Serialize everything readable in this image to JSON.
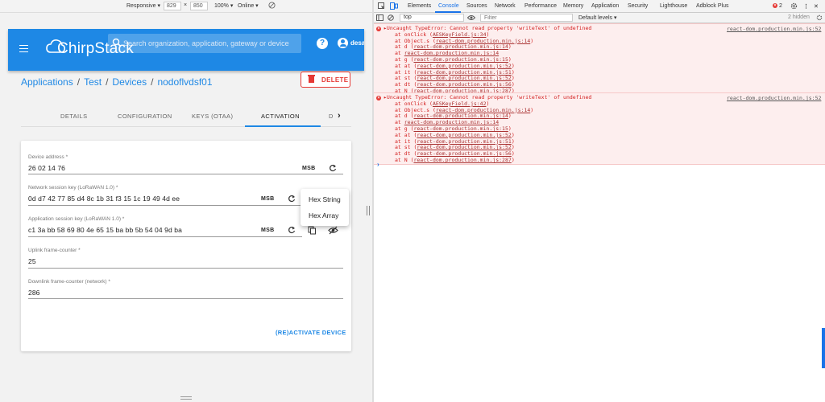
{
  "device_toolbar": {
    "preset": "Responsive ▾",
    "width": "829",
    "times": "×",
    "height": "850",
    "zoom": "100% ▾",
    "network": "Online ▾"
  },
  "app": {
    "logo_text": "ChirpStack",
    "search_placeholder": "Search organization, application, gateway or device",
    "help_label": "?",
    "username": "desar"
  },
  "breadcrumb": {
    "items": [
      "Applications",
      "Test",
      "Devices",
      "nodoflvdsf01"
    ],
    "separator": "/"
  },
  "delete_label": "DELETE",
  "tabs": [
    {
      "label": "DETAILS"
    },
    {
      "label": "CONFIGURATION"
    },
    {
      "label": "KEYS (OTAA)"
    },
    {
      "label": "ACTIVATION"
    },
    {
      "label": "D"
    }
  ],
  "tab_scroll": "›",
  "form": {
    "device_address": {
      "label": "Device address *",
      "value": "26 02 14 76",
      "order": "MSB"
    },
    "nwk_key": {
      "label": "Network session key (LoRaWAN 1.0) *",
      "value": "0d d7 42 77 85 d4 8c 1b 31 f3 15 1c 19 49 4d ee",
      "order": "MSB"
    },
    "app_key": {
      "label": "Application session key (LoRaWAN 1.0) *",
      "value": "c1 3a bb 58 69 80 4e 65 15 ba bb 5b 54 04 9d ba",
      "order": "MSB"
    },
    "uplink": {
      "label": "Uplink frame-counter *",
      "value": "25"
    },
    "downlink": {
      "label": "Downlink frame-counter (network) *",
      "value": "286"
    },
    "activate_label": "(RE)ACTIVATE DEVICE"
  },
  "popup_menu": [
    "Hex String",
    "Hex Array"
  ],
  "devtools": {
    "tabs": [
      "Elements",
      "Console",
      "Sources",
      "Network",
      "Performance",
      "Memory",
      "Application",
      "Security",
      "Lighthouse",
      "Adblock Plus"
    ],
    "active_tab": "Console",
    "error_count": "2",
    "context": "top",
    "filter_placeholder": "Filter",
    "levels": "Default levels ▾",
    "hidden": "2 hidden",
    "errors": [
      {
        "message": "▸Uncaught TypeError: Cannot read property 'writeText' of undefined",
        "source": "react-dom.production.min.js:52",
        "stack": [
          [
            "at onClick (",
            "AESKeyField.js:34",
            ")"
          ],
          [
            "at Object.s (",
            "react-dom.production.min.js:14",
            ")"
          ],
          [
            "at d (",
            "react-dom.production.min.js:14",
            ")"
          ],
          [
            "at ",
            "react-dom.production.min.js:14",
            ""
          ],
          [
            "at g (",
            "react-dom.production.min.js:15",
            ")"
          ],
          [
            "at at (",
            "react-dom.production.min.js:52",
            ")"
          ],
          [
            "at it (",
            "react-dom.production.min.js:51",
            ")"
          ],
          [
            "at st (",
            "react-dom.production.min.js:52",
            ")"
          ],
          [
            "at dt (",
            "react-dom.production.min.js:56",
            ")"
          ],
          [
            "at N (",
            "react-dom.production.min.js:287",
            ")"
          ]
        ]
      },
      {
        "message": "▸Uncaught TypeError: Cannot read property 'writeText' of undefined",
        "source": "react-dom.production.min.js:52",
        "stack": [
          [
            "at onClick (",
            "AESKeyField.js:42",
            ")"
          ],
          [
            "at Object.s (",
            "react-dom.production.min.js:14",
            ")"
          ],
          [
            "at d (",
            "react-dom.production.min.js:14",
            ")"
          ],
          [
            "at ",
            "react-dom.production.min.js:14",
            ""
          ],
          [
            "at g (",
            "react-dom.production.min.js:15",
            ")"
          ],
          [
            "at at (",
            "react-dom.production.min.js:52",
            ")"
          ],
          [
            "at it (",
            "react-dom.production.min.js:51",
            ")"
          ],
          [
            "at st (",
            "react-dom.production.min.js:52",
            ")"
          ],
          [
            "at dt (",
            "react-dom.production.min.js:56",
            ")"
          ],
          [
            "at N (",
            "react-dom.production.min.js:287",
            ")"
          ]
        ]
      }
    ],
    "prompt": "›"
  },
  "colors": {
    "brand_blue": "#1e88e5",
    "delete_red": "#e53935",
    "error_bg": "#fdeeee",
    "error_text": "#d31f1f",
    "devtools_accent": "#1a73e8"
  }
}
